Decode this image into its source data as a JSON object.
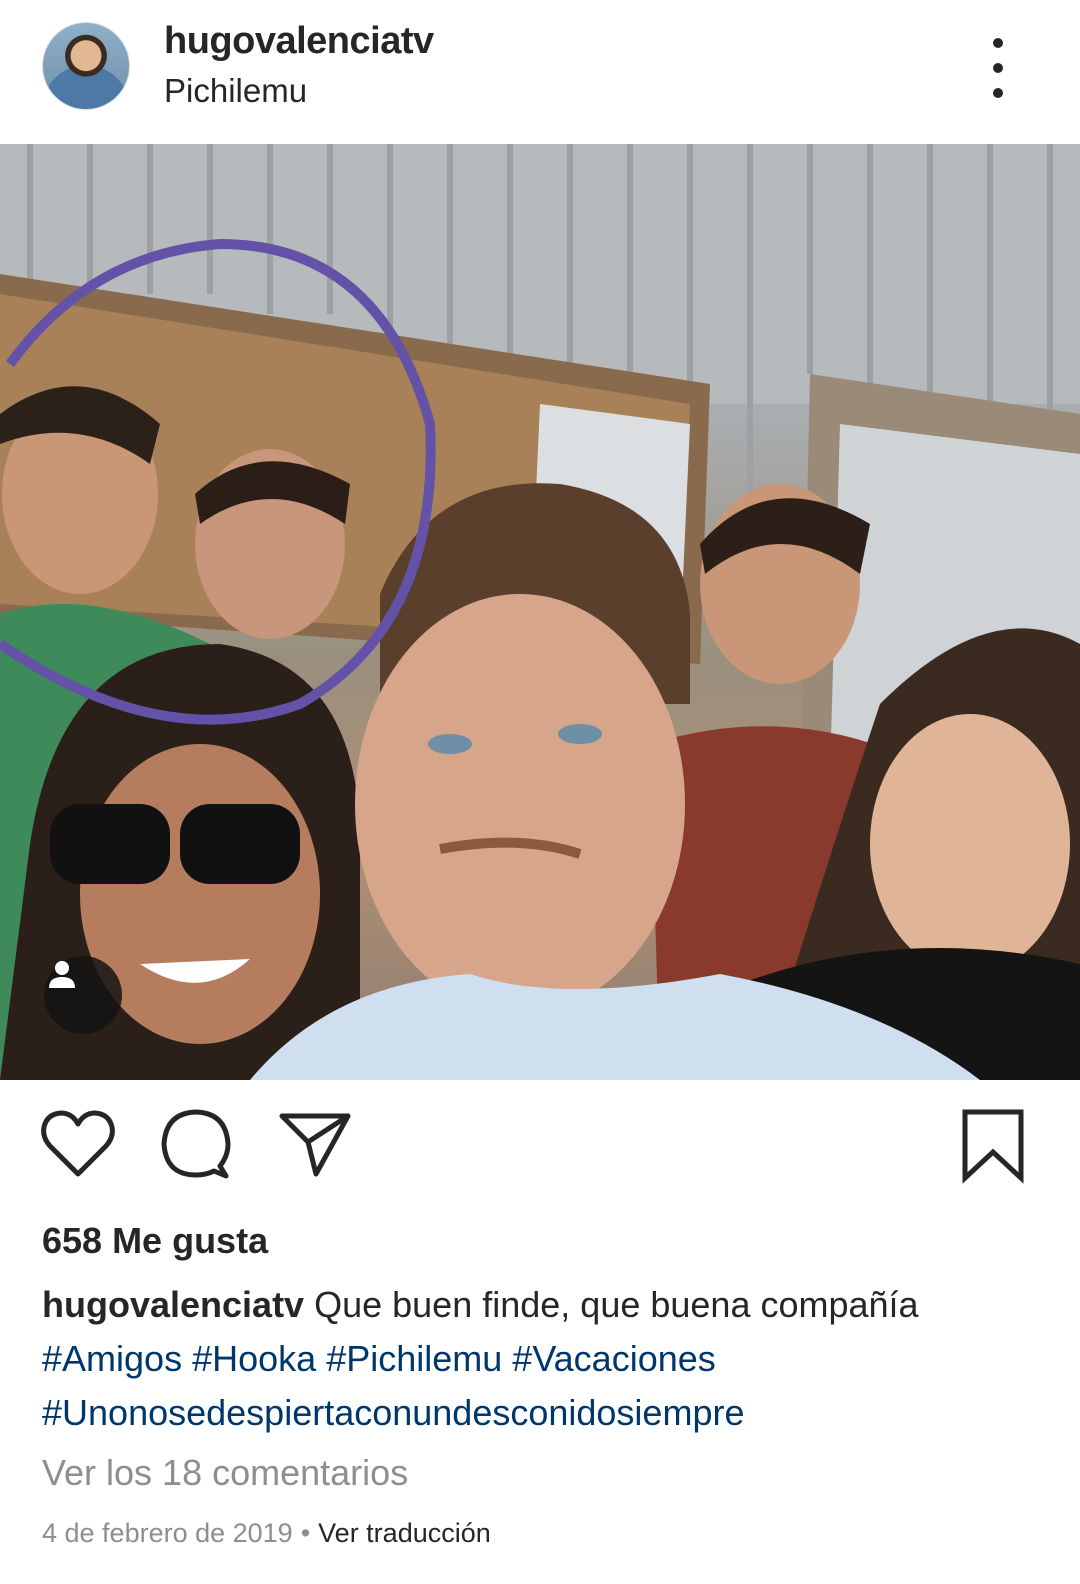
{
  "post": {
    "username": "hugovalenciatv",
    "location": "Pichilemu",
    "likes": "658 Me gusta",
    "caption_text": "Que buen finde, que buena compañía",
    "hashtags": [
      "#Amigos",
      "#Hooka",
      "#Pichilemu",
      "#Vacaciones",
      "#Unonosedespiertaconundesconidosiempre"
    ],
    "view_comments": "Ver los 18 comentarios",
    "date": "4 de febrero de 2019",
    "separator": "•",
    "translate": "Ver traducción"
  },
  "icons": {
    "more": "more-options-icon",
    "tag": "user-tag-icon",
    "like": "heart-icon",
    "comment": "comment-icon",
    "share": "paper-plane-icon",
    "save": "bookmark-icon"
  },
  "colors": {
    "text": "#262626",
    "muted": "#8e8e8e",
    "hashtag": "#00376b",
    "annotation_circle": "#6452a8"
  }
}
